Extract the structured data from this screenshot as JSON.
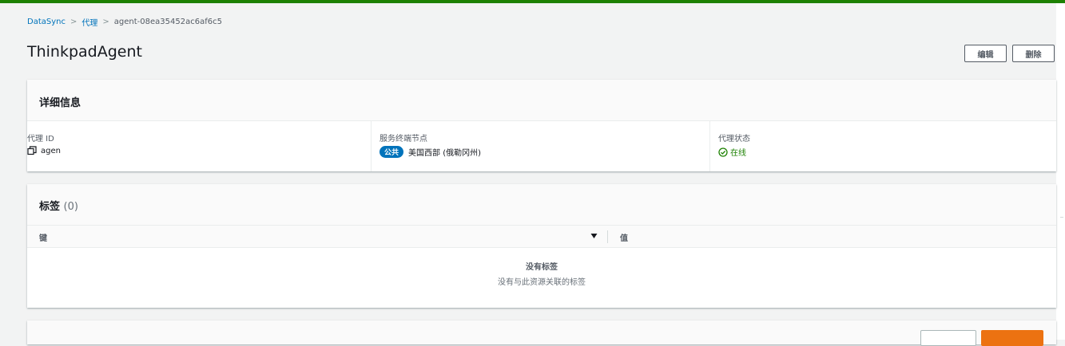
{
  "theme": {
    "top_bar": "#1d8102",
    "link": "#0073bb",
    "success": "#1d8102",
    "badge": "#0073bb",
    "primary": "#ec7211"
  },
  "breadcrumb": [
    {
      "label": "DataSync"
    },
    {
      "label": "代理"
    },
    {
      "label": "agent-08ea35452ac6af6c5"
    }
  ],
  "page": {
    "title": "ThinkpadAgent",
    "actions": {
      "edit": "编辑",
      "delete": "删除"
    }
  },
  "details": {
    "title": "详细信息",
    "agent_id": {
      "label": "代理 ID",
      "value": "agen",
      "icon": "copy-icon"
    },
    "endpoint": {
      "label": "服务终端节点",
      "badge": "公共",
      "value": "美国西部 (俄勒冈州)"
    },
    "status": {
      "label": "代理状态",
      "value": "在线",
      "icon": "check-circle-icon"
    }
  },
  "tags": {
    "title": "标签",
    "count": "(0)",
    "columns": {
      "key": "键",
      "value": "值"
    },
    "sort_icon": "caret-down-icon",
    "empty_title": "没有标签",
    "empty_desc": "没有与此资源关联的标签"
  }
}
